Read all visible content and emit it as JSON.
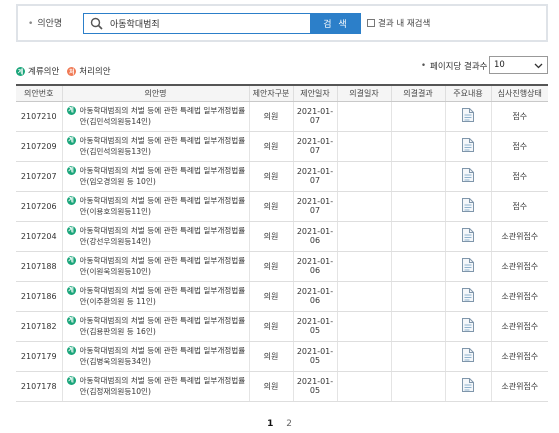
{
  "search": {
    "label": "의안명",
    "value": "아동학대범죄",
    "button": "검 색",
    "within_label": "결과 내 재검색"
  },
  "legend": {
    "pending": "계류의안",
    "processed": "처리의안",
    "pending_badge": "계",
    "processed_badge": "처"
  },
  "per_page": {
    "label": "페이지당 결과수",
    "value": "10"
  },
  "table": {
    "headers": [
      "의안번호",
      "의안명",
      "제안자구분",
      "제안일자",
      "의결일자",
      "의결결과",
      "주요내용",
      "심사진행상태"
    ],
    "rows": [
      {
        "no": "2107210",
        "name": "아동학대범죄의 처벌 등에 관한 특례법 일부개정법률안(김민석의원등14인)",
        "proposer": "의원",
        "date": "2021-01-07",
        "vote_date": "",
        "result": "",
        "status": "접수"
      },
      {
        "no": "2107209",
        "name": "아동학대범죄의 처벌 등에 관한 특례법 일부개정법률안(김민석의원등13인)",
        "proposer": "의원",
        "date": "2021-01-07",
        "vote_date": "",
        "result": "",
        "status": "접수"
      },
      {
        "no": "2107207",
        "name": "아동학대범죄의 처벌 등에 관한 특례법 일부개정법률안(임오경의원 등 10인)",
        "proposer": "의원",
        "date": "2021-01-07",
        "vote_date": "",
        "result": "",
        "status": "접수"
      },
      {
        "no": "2107206",
        "name": "아동학대범죄의 처벌 등에 관한 특례법 일부개정법률안(이용호의원등11인)",
        "proposer": "의원",
        "date": "2021-01-07",
        "vote_date": "",
        "result": "",
        "status": "접수"
      },
      {
        "no": "2107204",
        "name": "아동학대범죄의 처벌 등에 관한 특례법 일부개정법률안(강선우의원등14인)",
        "proposer": "의원",
        "date": "2021-01-06",
        "vote_date": "",
        "result": "",
        "status": "소관위접수"
      },
      {
        "no": "2107188",
        "name": "아동학대범죄의 처벌 등에 관한 특례법 일부개정법률안(이원욱의원등10인)",
        "proposer": "의원",
        "date": "2021-01-06",
        "vote_date": "",
        "result": "",
        "status": "소관위접수"
      },
      {
        "no": "2107186",
        "name": "아동학대범죄의 처벌 등에 관한 특례법 일부개정법률안(이주환의원 등 11인)",
        "proposer": "의원",
        "date": "2021-01-06",
        "vote_date": "",
        "result": "",
        "status": "소관위접수"
      },
      {
        "no": "2107182",
        "name": "아동학대범죄의 처벌 등에 관한 특례법 일부개정법률안(김용판의원 등 16인)",
        "proposer": "의원",
        "date": "2021-01-05",
        "vote_date": "",
        "result": "",
        "status": "소관위접수"
      },
      {
        "no": "2107179",
        "name": "아동학대범죄의 처벌 등에 관한 특례법 일부개정법률안(김병욱의원등34인)",
        "proposer": "의원",
        "date": "2021-01-05",
        "vote_date": "",
        "result": "",
        "status": "소관위접수"
      },
      {
        "no": "2107178",
        "name": "아동학대범죄의 처벌 등에 관한 특례법 일부개정법률안(김정재의원등10인)",
        "proposer": "의원",
        "date": "2021-01-05",
        "vote_date": "",
        "result": "",
        "status": "소관위접수"
      }
    ]
  },
  "pagination": {
    "pages": [
      "1",
      "2"
    ],
    "current": "1"
  },
  "icons": {
    "search": "search-icon",
    "document": "document-icon",
    "chevron": "chevron-down-icon"
  },
  "colors": {
    "accent": "#2c7fc9",
    "pending_badge": "#1aa57a",
    "processed_badge": "#f07a55"
  }
}
